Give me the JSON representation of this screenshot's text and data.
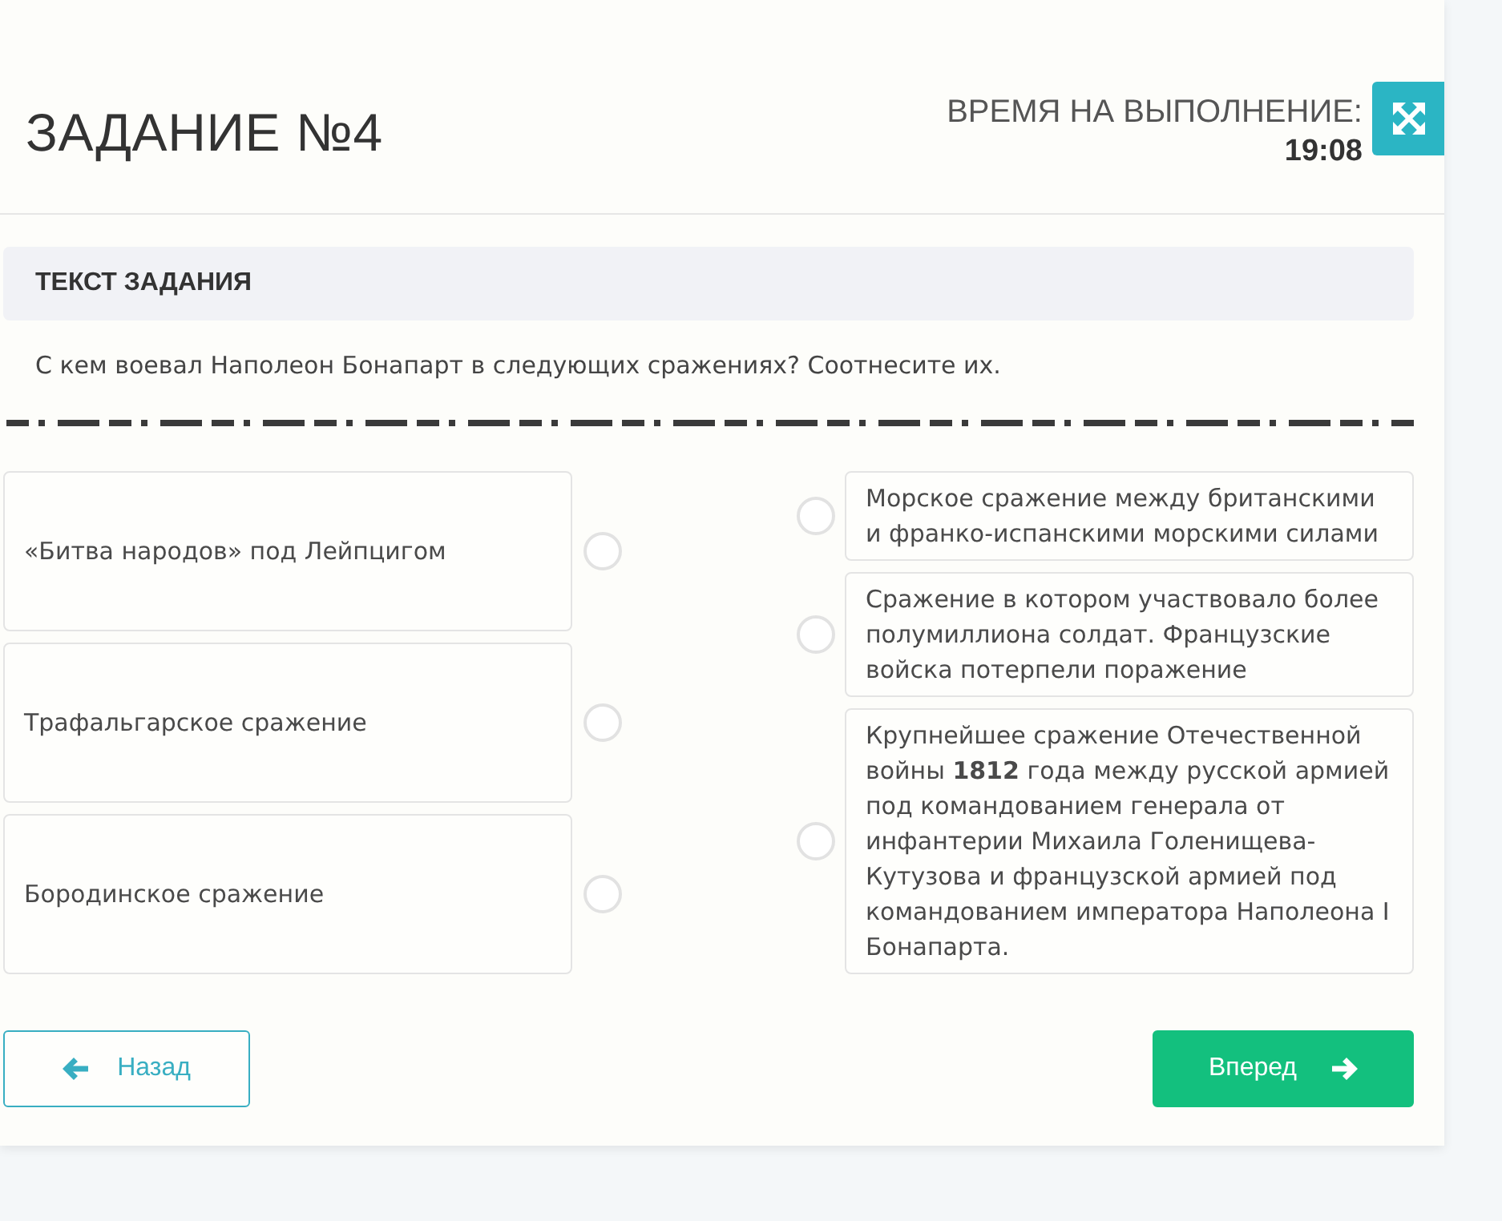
{
  "header": {
    "title": "ЗАДАНИЕ №4",
    "timer_label": "ВРЕМЯ НА ВЫПОЛНЕНИЕ:",
    "timer_value": "19:08"
  },
  "task": {
    "heading": "ТЕКСТ ЗАДАНИЯ",
    "question": "С кем воевал Наполеон Бонапарт в следующих сражениях? Соотнесите их."
  },
  "left_items": [
    {
      "text": "«Битва народов» под Лейпцигом",
      "selected": false
    },
    {
      "text": "Трафальгарское сражение",
      "selected": false
    },
    {
      "text": "Бородинское сражение",
      "selected": false
    }
  ],
  "right_items": [
    {
      "text": "Морское сражение между британскими и франко-испанскими морскими силами",
      "selected": false
    },
    {
      "text": "Сражение в котором участвовало более полумиллиона солдат. Французские войска потерпели поражение",
      "selected": false
    },
    {
      "text": "Крупнейшее сражение Отечественной войны **1812** года между русской армией под командованием генерала от инфантерии Михаила Голенищева-Кутузова и французской армией под командованием императора Наполеона I Бонапарта.",
      "selected": false
    }
  ],
  "buttons": [
    {
      "kind": "back",
      "label": "Назад"
    },
    {
      "kind": "next",
      "label": "Вперед"
    }
  ]
}
